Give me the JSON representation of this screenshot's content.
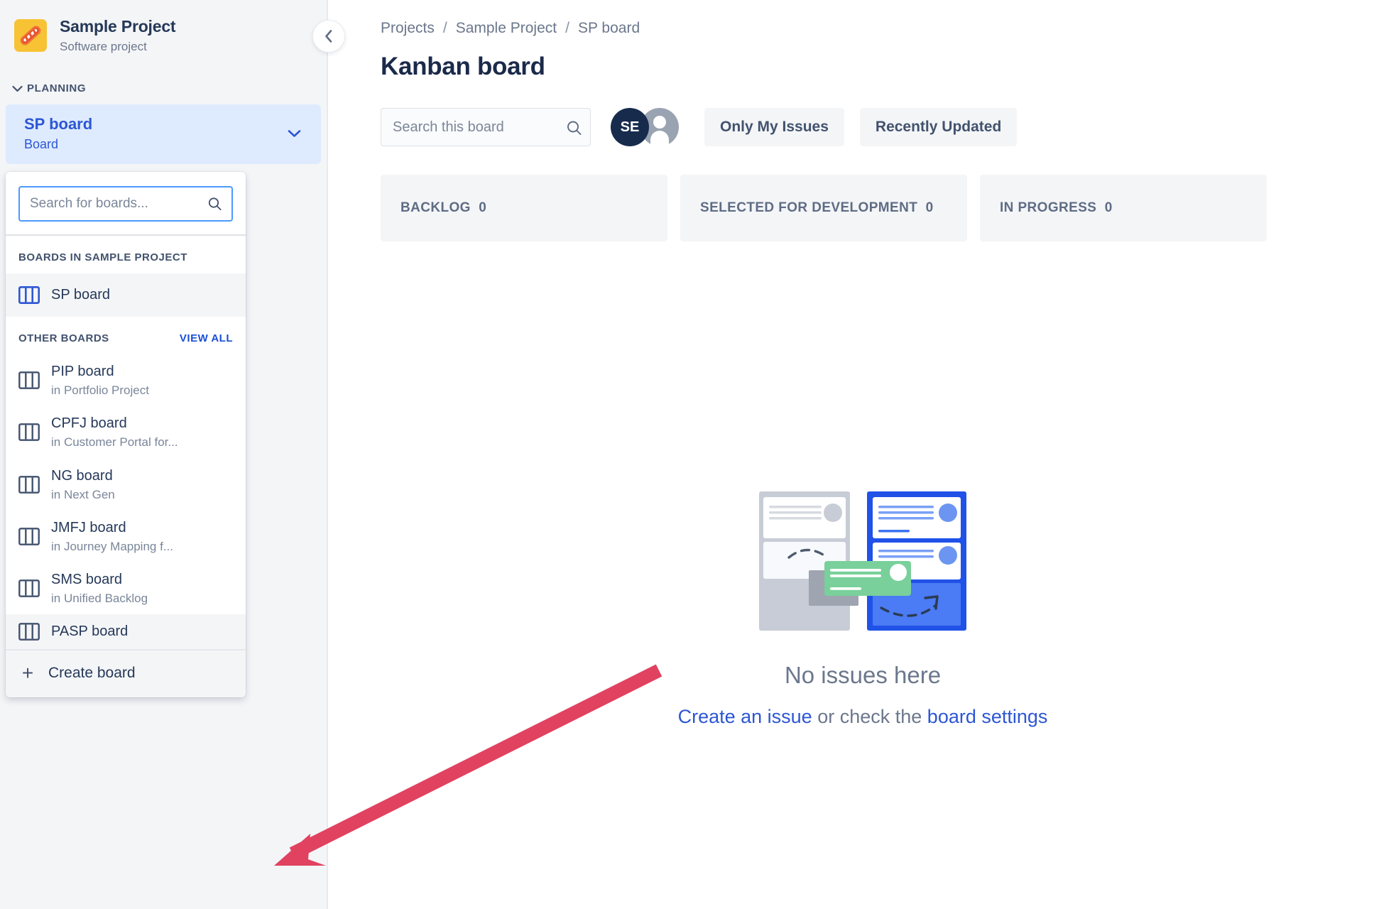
{
  "sidebar": {
    "project": {
      "name": "Sample Project",
      "subtitle": "Software project",
      "avatar_icon": "hotdog-icon",
      "avatar_color": "#f7c335"
    },
    "planning_section": {
      "label": "PLANNING",
      "chevron_icon": "chevron-down-icon"
    },
    "active_item": {
      "title": "SP board",
      "subtitle": "Board",
      "chevron_icon": "chevron-down-icon",
      "highlight_color": "#deebff",
      "text_color": "#2d56d4"
    }
  },
  "board_dropdown": {
    "search": {
      "placeholder": "Search for boards...",
      "value": "",
      "icon": "search-icon"
    },
    "current_project_section": {
      "heading": "BOARDS IN SAMPLE PROJECT",
      "items": [
        {
          "title": "SP board",
          "subtitle": "",
          "icon": "board-columns-icon",
          "selected": true
        }
      ]
    },
    "other_boards_section": {
      "heading": "OTHER BOARDS",
      "view_all_label": "VIEW ALL",
      "items": [
        {
          "title": "PIP board",
          "subtitle": "in Portfolio Project",
          "icon": "board-columns-icon"
        },
        {
          "title": "CPFJ board",
          "subtitle": "in Customer Portal for...",
          "icon": "board-columns-icon"
        },
        {
          "title": "NG board",
          "subtitle": "in Next Gen",
          "icon": "board-columns-icon"
        },
        {
          "title": "JMFJ board",
          "subtitle": "in Journey Mapping f...",
          "icon": "board-columns-icon"
        },
        {
          "title": "SMS board",
          "subtitle": "in Unified Backlog",
          "icon": "board-columns-icon"
        },
        {
          "title": "PASP board",
          "subtitle": "",
          "icon": "board-columns-icon"
        }
      ]
    },
    "create_board": {
      "label": "Create board",
      "icon": "plus-icon"
    }
  },
  "collapse_button": {
    "icon": "chevron-left-icon"
  },
  "main": {
    "breadcrumb": {
      "items": [
        "Projects",
        "Sample Project",
        "SP board"
      ],
      "separator": "/"
    },
    "page_title": "Kanban board",
    "toolbar": {
      "search": {
        "placeholder": "Search this board",
        "value": "",
        "icon": "search-icon"
      },
      "avatars": [
        {
          "initials": "SE",
          "type": "user",
          "color": "#172b4d"
        },
        {
          "initials": "",
          "type": "anonymous",
          "color": "#9aa3b2"
        }
      ],
      "filters": [
        {
          "label": "Only My Issues"
        },
        {
          "label": "Recently Updated"
        }
      ]
    },
    "columns": [
      {
        "name": "BACKLOG",
        "count": "0"
      },
      {
        "name": "SELECTED FOR DEVELOPMENT",
        "count": "0"
      },
      {
        "name": "IN PROGRESS",
        "count": "0"
      }
    ],
    "empty_state": {
      "illustration": "kanban-board-illustration",
      "title": "No issues here",
      "link_create": "Create an issue",
      "middle_text": " or check the ",
      "link_settings": "board settings"
    }
  },
  "annotation": {
    "arrow_color": "#e04260",
    "points_to": "create-board"
  }
}
